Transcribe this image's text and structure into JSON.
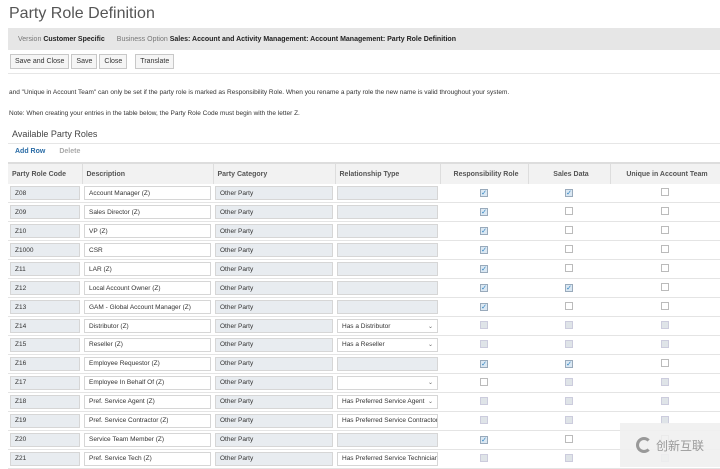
{
  "title": "Party Role Definition",
  "info": {
    "version_label": "Version",
    "version_value": "Customer Specific",
    "option_label": "Business Option",
    "option_value": "Sales: Account and Activity Management: Account Management: Party Role Definition"
  },
  "buttons": {
    "save_close": "Save and Close",
    "save": "Save",
    "close": "Close",
    "translate": "Translate"
  },
  "text1": "and \"Unique in Account Team\" can only be set if the party role is marked as Responsibility Role. When you rename a party role the new name is valid throughout your system.",
  "text2": "Note: When creating your entries in the table below, the Party Role Code must begin with the letter Z.",
  "section_title": "Available Party Roles",
  "toolbar": {
    "add_row": "Add Row",
    "delete": "Delete"
  },
  "columns": [
    "Party Role Code",
    "Description",
    "Party Category",
    "Relationship Type",
    "Responsibility Role",
    "Sales Data",
    "Unique in Account Team"
  ],
  "rows": [
    {
      "code": "Z08",
      "desc": "Account Manager (Z)",
      "cat": "Other Party",
      "rel": "",
      "rel_select": false,
      "resp": "checked",
      "sales": "checked",
      "unique": "unchecked"
    },
    {
      "code": "Z09",
      "desc": "Sales Director (Z)",
      "cat": "Other Party",
      "rel": "",
      "rel_select": false,
      "resp": "checked",
      "sales": "unchecked",
      "unique": "unchecked"
    },
    {
      "code": "Z10",
      "desc": "VP (Z)",
      "cat": "Other Party",
      "rel": "",
      "rel_select": false,
      "resp": "checked",
      "sales": "unchecked",
      "unique": "unchecked"
    },
    {
      "code": "Z1000",
      "desc": "CSR",
      "cat": "Other Party",
      "rel": "",
      "rel_select": false,
      "resp": "checked",
      "sales": "unchecked",
      "unique": "unchecked"
    },
    {
      "code": "Z11",
      "desc": "LAR (Z)",
      "cat": "Other Party",
      "rel": "",
      "rel_select": false,
      "resp": "checked",
      "sales": "unchecked",
      "unique": "unchecked"
    },
    {
      "code": "Z12",
      "desc": " Local Account Owner (Z)",
      "cat": "Other Party",
      "rel": "",
      "rel_select": false,
      "resp": "checked",
      "sales": "checked",
      "unique": "unchecked"
    },
    {
      "code": "Z13",
      "desc": "GAM - Global Account Manager (Z)",
      "cat": "Other Party",
      "rel": "",
      "rel_select": false,
      "resp": "checked",
      "sales": "unchecked",
      "unique": "unchecked"
    },
    {
      "code": "Z14",
      "desc": "Distributor (Z)",
      "cat": "Other Party",
      "rel": "Has a Distributor",
      "rel_select": true,
      "resp": "disabled",
      "sales": "disabled",
      "unique": "disabled"
    },
    {
      "code": "Z15",
      "desc": "Reseller (Z)",
      "cat": "Other Party",
      "rel": "Has a Reseller",
      "rel_select": true,
      "resp": "disabled",
      "sales": "disabled",
      "unique": "disabled"
    },
    {
      "code": "Z16",
      "desc": "Employee Requestor (Z)",
      "cat": "Other Party",
      "rel": "",
      "rel_select": false,
      "resp": "checked",
      "sales": "checked",
      "unique": "unchecked"
    },
    {
      "code": "Z17",
      "desc": "Employee In Behalf Of (Z)",
      "cat": "Other Party",
      "rel": "",
      "rel_select": true,
      "resp": "unchecked",
      "sales": "disabled",
      "unique": "disabled"
    },
    {
      "code": "Z18",
      "desc": "Pref. Service Agent (Z)",
      "cat": "Other Party",
      "rel": "Has Preferred Service Agent",
      "rel_select": true,
      "resp": "disabled",
      "sales": "disabled",
      "unique": "disabled"
    },
    {
      "code": "Z19",
      "desc": "Pref. Service Contractor (Z)",
      "cat": "Other Party",
      "rel": "Has Preferred Service Contractor",
      "rel_select": true,
      "resp": "disabled",
      "sales": "disabled",
      "unique": "disabled"
    },
    {
      "code": "Z20",
      "desc": "Service Team Member (Z)",
      "cat": "Other Party",
      "rel": "",
      "rel_select": false,
      "resp": "checked",
      "sales": "unchecked",
      "unique": "unchecked"
    },
    {
      "code": "Z21",
      "desc": "Pref. Service Tech (Z)",
      "cat": "Other Party",
      "rel": "Has Preferred Service Technician",
      "rel_select": true,
      "resp": "disabled",
      "sales": "disabled",
      "unique": "disabled"
    }
  ],
  "watermark": "创新互联"
}
